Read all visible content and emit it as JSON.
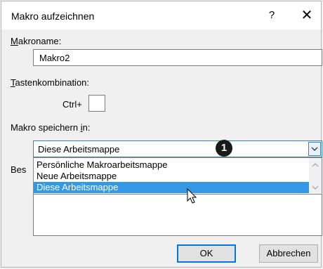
{
  "dialog": {
    "title": "Makro aufzeichnen",
    "help": "?",
    "close": "✕"
  },
  "name": {
    "label_u": "M",
    "label_rest": "akroname:",
    "value": "Makro2"
  },
  "shortcut": {
    "label_u": "T",
    "label_rest": "astenkombination:",
    "prefix": "Ctrl+",
    "value": ""
  },
  "store": {
    "label_pre": "Makro speichern ",
    "label_u": "i",
    "label_post": "n:",
    "selected": "Diese Arbeitsmappe",
    "options": [
      "Persönliche Makroarbeitsmappe",
      "Neue Arbeitsmappe",
      "Diese Arbeitsmappe"
    ],
    "highlighted_index": 2
  },
  "description": {
    "label_visible": "Bes"
  },
  "callout": "1",
  "buttons": {
    "ok": "OK",
    "cancel": "Abbrechen"
  },
  "colors": {
    "accent": "#0078d7",
    "selection": "#3399e6"
  }
}
